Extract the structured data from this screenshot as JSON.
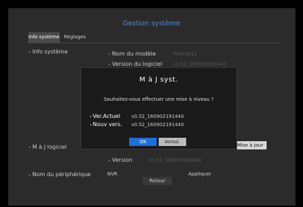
{
  "window": {
    "title": "Gestion système"
  },
  "tabs": [
    {
      "label": "Info système",
      "active": true
    },
    {
      "label": "Réglages",
      "active": false
    }
  ],
  "sections": {
    "info_systeme": {
      "heading": "Info système",
      "fields": [
        {
          "label": "Nom du modèle",
          "value": "PRN-4011"
        },
        {
          "label": "Version du logiciel",
          "value": "v0.52_160902191440"
        }
      ]
    },
    "maj_logiciel": {
      "heading": "M à J logiciel",
      "update_button": "Mise à jour",
      "version_label": "Version",
      "version_value": "V0.52_160902191440"
    },
    "device_name": {
      "heading": "Nom du périphérique",
      "value": "NVR",
      "apply_label": "Appliquer"
    }
  },
  "footer": {
    "back_label": "Retour"
  },
  "modal": {
    "title": "M à J syst.",
    "question": "Souhaitez-vous effectuer une mise à niveau ?",
    "current_label": "Ver.Actuel",
    "current_value": "v0.52_160902191440",
    "new_label": "Nouv vers.",
    "new_value": "v0.52_160902191440",
    "ok_label": "OK",
    "cancel_label": "Annul."
  },
  "colors": {
    "accent": "#4a90d9",
    "ok_button": "#1e6fd9",
    "panel": "#2b2b2b"
  }
}
